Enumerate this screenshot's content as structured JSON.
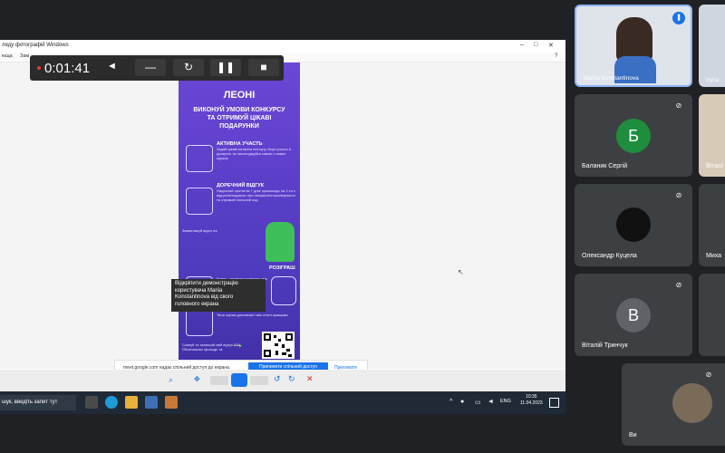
{
  "window": {
    "title": "ляду фотографій Windows",
    "menu": [
      "юща",
      "Зам"
    ]
  },
  "recorder": {
    "timer": "0:01:41"
  },
  "poster": {
    "heading": "ЛЕОНІ",
    "subheading_line1": "ВИКОНУЙ УМОВИ КОНКУРСУ",
    "subheading_line2": "ТА ОТРИМУЙ ЦІКАВІ",
    "subheading_line3": "ПОДАРУНКИ",
    "sections": [
      {
        "title": "АКТИВНА УЧАСТЬ",
        "desc": "Задай цікаві питання лектору, бери участь в дискусію та насолоджуйся кавою з нових кружок"
      },
      {
        "title": "ДОРЕЧНИЙ ВІДГУК",
        "desc": "Надсилай протягом 7 днів промокоди на 2 та з відгуком/подякою про лекцію/лектора/воркшоп та отримай спільний код"
      },
      {
        "title": "Завантажуй відео на",
        "desc": ""
      },
      {
        "title": "РОЗІГРАШ",
        "desc": "Бонус - розіграш розіграш між усіма учасниками після кожної лекції"
      },
      {
        "title": "ОЦІНИ НАШ ЗАХІД",
        "desc": "Твоя оцінка допоможе нам стати кращими"
      }
    ],
    "footer": "Скануй та залишай свій відгук P.S. Обов'язково приходь та"
  },
  "tooltip": {
    "line1": "Відкріпити демонстрацію",
    "line2": "користувача Mariia",
    "line3": "Konstantinova від свого",
    "line4": "головного екрана"
  },
  "share_notice": {
    "message": "meet.google.com надає спільний доступ до екрана.",
    "stop_label": "Припинити спільний доступ",
    "hide_label": "Приховати"
  },
  "taskbar": {
    "search_placeholder": "шук, введіть запит тут",
    "lang": "ENG",
    "time": "10:35",
    "date": "11.04.2023"
  },
  "participants": [
    {
      "name": "Mariia Konstantinova",
      "active": true
    },
    {
      "name": "Iryna",
      "initial": ""
    },
    {
      "name": "Баланик Сергій",
      "initial": "Б",
      "color": "#1e8e3e"
    },
    {
      "name": "Віталі",
      "initial": ""
    },
    {
      "name": "Олександр Куцела",
      "initial": ""
    },
    {
      "name": "Миха",
      "initial": ""
    },
    {
      "name": "Віталій Тринчук",
      "initial": "В",
      "color": "#5f6368"
    },
    {
      "name": "Ви",
      "initial": ""
    }
  ],
  "colors": {
    "meet_bg": "#202124",
    "tile_bg": "#3c4043",
    "accent": "#1a73e8",
    "poster_purple": "#5c3fc9"
  }
}
